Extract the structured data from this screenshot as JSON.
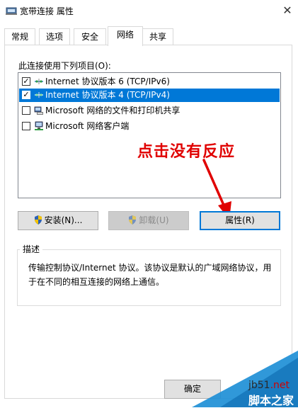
{
  "window": {
    "title": "宽带连接 属性",
    "close_glyph": "✕"
  },
  "tabs": [
    {
      "label": "常规",
      "active": false
    },
    {
      "label": "选项",
      "active": false
    },
    {
      "label": "安全",
      "active": false
    },
    {
      "label": "网络",
      "active": true
    },
    {
      "label": "共享",
      "active": false
    }
  ],
  "connection_label": "此连接使用下列项目(O):",
  "items": [
    {
      "label": "Internet 协议版本 6 (TCP/IPv6)",
      "checked": true,
      "selected": false,
      "icon": "network-protocol-icon"
    },
    {
      "label": "Internet 协议版本 4 (TCP/IPv4)",
      "checked": true,
      "selected": true,
      "icon": "network-protocol-icon"
    },
    {
      "label": "Microsoft 网络的文件和打印机共享",
      "checked": false,
      "selected": false,
      "icon": "file-printer-sharing-icon"
    },
    {
      "label": "Microsoft 网络客户端",
      "checked": false,
      "selected": false,
      "icon": "network-client-icon"
    }
  ],
  "buttons": {
    "install": "安装(N)...",
    "uninstall": "卸载(U)",
    "properties": "属性(R)",
    "ok": "确定"
  },
  "description": {
    "legend": "描述",
    "text": "传输控制协议/Internet 协议。该协议是默认的广域网络协议，用于在不同的相互连接的网络上通信。"
  },
  "annotation": {
    "text": "点击没有反应",
    "color": "#e00000"
  },
  "watermark": {
    "site_prefix": "jb51",
    "site_suffix": ".net",
    "brand": "脚本之家"
  },
  "colors": {
    "selection": "#0078d7",
    "accent": "#0078d7"
  }
}
